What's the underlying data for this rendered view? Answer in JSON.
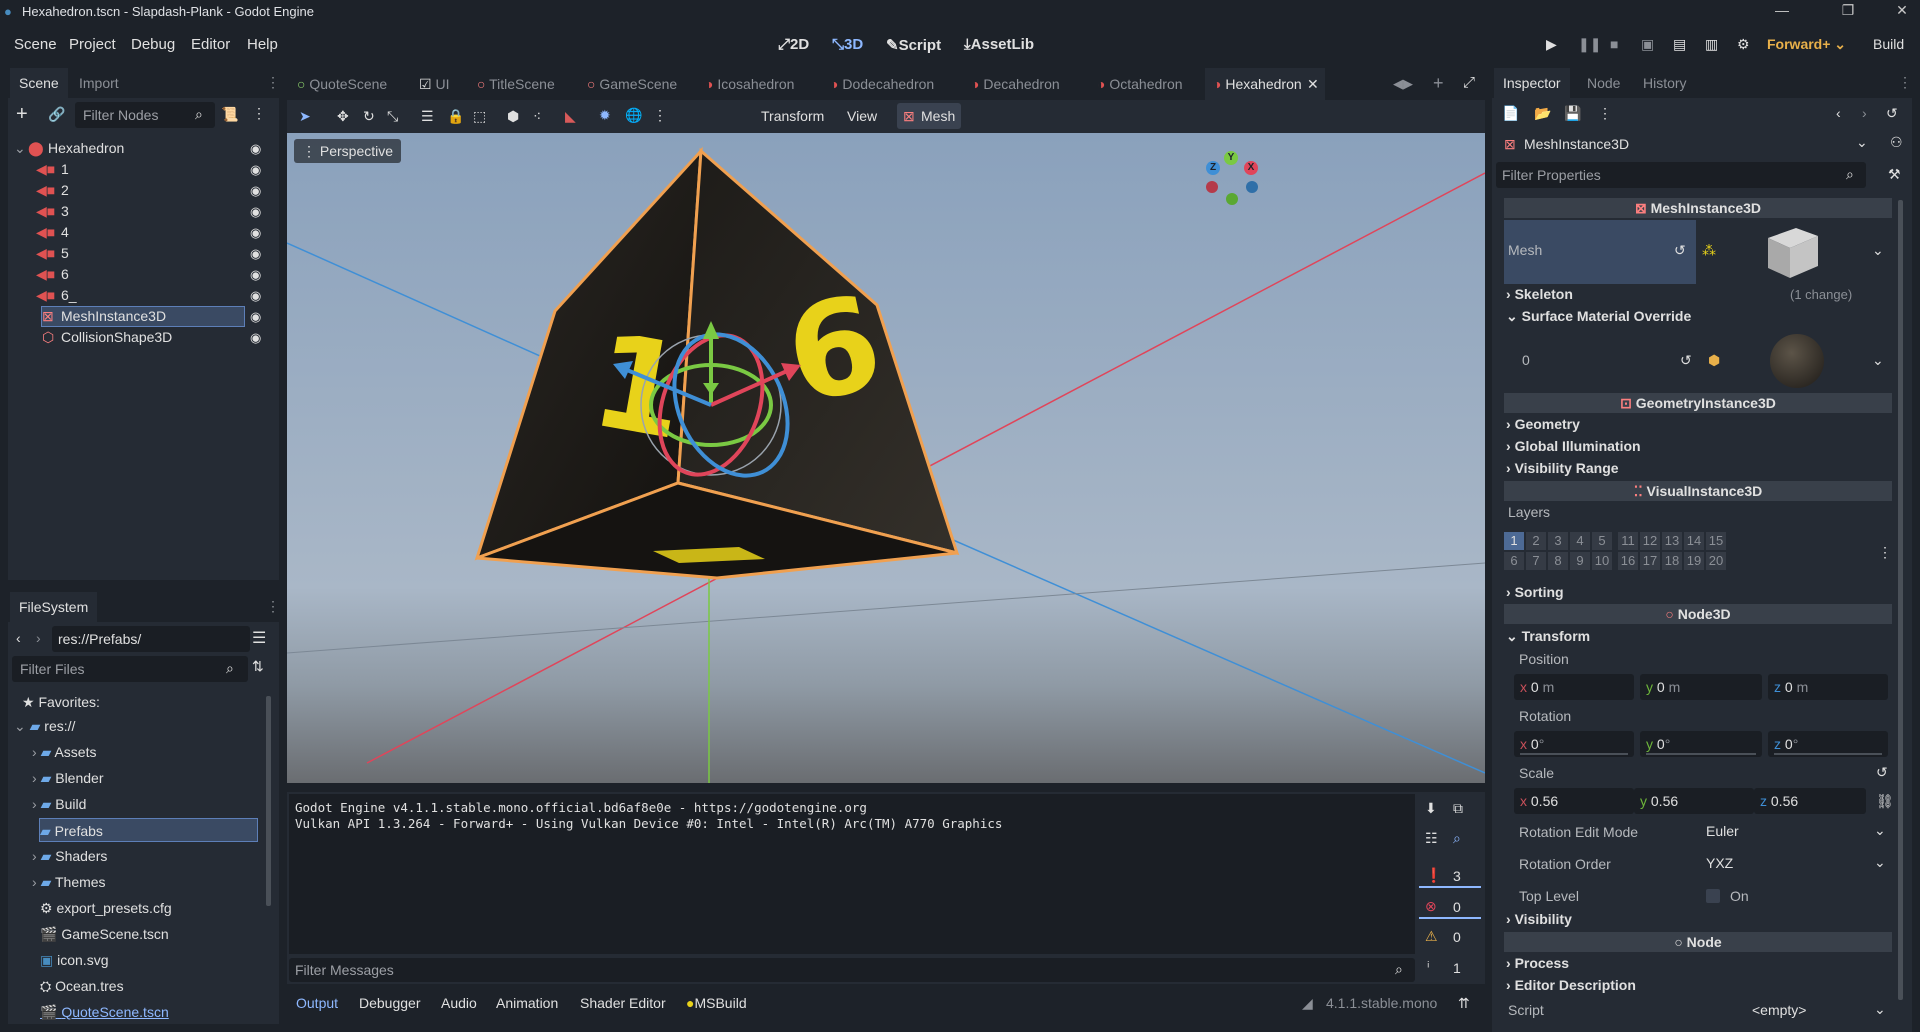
{
  "window": {
    "title": "Hexahedron.tscn - Slapdash-Plank - Godot Engine"
  },
  "menu": [
    "Scene",
    "Project",
    "Debug",
    "Editor",
    "Help"
  ],
  "workspaces": {
    "w2d": "2D",
    "w3d": "3D",
    "script": "Script",
    "assetlib": "AssetLib"
  },
  "renderer": "Forward+",
  "build_label": "Build",
  "scene_dock": {
    "tabs": [
      "Scene",
      "Import"
    ],
    "filter_placeholder": "Filter Nodes",
    "root": "Hexahedron",
    "children": [
      "1",
      "2",
      "3",
      "4",
      "5",
      "6",
      "6_",
      "MeshInstance3D",
      "CollisionShape3D"
    ],
    "selected": "MeshInstance3D"
  },
  "filesystem": {
    "tab": "FileSystem",
    "path": "res://Prefabs/",
    "filter_placeholder": "Filter Files",
    "favorites": "Favorites:",
    "root": "res://",
    "items": [
      "Assets",
      "Blender",
      "Build",
      "Prefabs",
      "Shaders",
      "Themes",
      "export_presets.cfg",
      "GameScene.tscn",
      "icon.svg",
      "Ocean.tres",
      "QuoteScene.tscn"
    ],
    "selected": "Prefabs"
  },
  "doc_tabs": [
    "QuoteScene",
    "UI",
    "TitleScene",
    "GameScene",
    "Icosahedron",
    "Dodecahedron",
    "Decahedron",
    "Octahedron",
    "Hexahedron"
  ],
  "active_doc": "Hexahedron",
  "toolbar": {
    "transform": "Transform",
    "view": "View",
    "mesh": "Mesh"
  },
  "viewport": {
    "perspective": "Perspective",
    "gizmo": {
      "x": "X",
      "y": "Y",
      "z": "Z"
    },
    "die_faces": [
      "1",
      "6"
    ]
  },
  "output": {
    "lines": [
      "Godot Engine v4.1.1.stable.mono.official.bd6af8e0e - https://godotengine.org",
      "Vulkan API 1.3.264 - Forward+ - Using Vulkan Device #0: Intel - Intel(R) Arc(TM) A770 Graphics"
    ],
    "filter_placeholder": "Filter Messages",
    "counts": {
      "messages": "3",
      "errors": "0",
      "warnings": "0",
      "info": "1"
    }
  },
  "bottom_tabs": [
    "Output",
    "Debugger",
    "Audio",
    "Animation",
    "Shader Editor",
    "MSBuild"
  ],
  "version": "4.1.1.stable.mono",
  "inspector": {
    "tabs": [
      "Inspector",
      "Node",
      "History"
    ],
    "node": "MeshInstance3D",
    "filter_placeholder": "Filter Properties",
    "class_mesh": "MeshInstance3D",
    "mesh_label": "Mesh",
    "skeleton": "Skeleton",
    "skeleton_note": "(1 change)",
    "surface_override": "Surface Material Override",
    "surface_index": "0",
    "class_geometry": "GeometryInstance3D",
    "geometry": "Geometry",
    "gi": "Global Illumination",
    "visibility_range": "Visibility Range",
    "class_visual": "VisualInstance3D",
    "layers_label": "Layers",
    "layers_row1": [
      "1",
      "2",
      "3",
      "4",
      "5",
      "11",
      "12",
      "13",
      "14",
      "15"
    ],
    "layers_row2": [
      "6",
      "7",
      "8",
      "9",
      "10",
      "16",
      "17",
      "18",
      "19",
      "20"
    ],
    "sorting": "Sorting",
    "class_node3d": "Node3D",
    "transform": "Transform",
    "position": "Position",
    "position_vals": {
      "x": "0",
      "y": "0",
      "z": "0",
      "unit": "m"
    },
    "rotation": "Rotation",
    "rotation_vals": {
      "x": "0",
      "y": "0",
      "z": "0",
      "unit": "°"
    },
    "scale": "Scale",
    "scale_vals": {
      "x": "0.56",
      "y": "0.56",
      "z": "0.56"
    },
    "rotation_edit_mode": "Rotation Edit Mode",
    "rotation_edit_mode_val": "Euler",
    "rotation_order": "Rotation Order",
    "rotation_order_val": "YXZ",
    "top_level": "Top Level",
    "top_level_val": "On",
    "visibility": "Visibility",
    "class_node": "Node",
    "process": "Process",
    "editor_description": "Editor Description",
    "script": "Script",
    "script_val": "<empty>"
  },
  "colors": {
    "accent": "#8eb8ff",
    "panel": "#252b34",
    "background": "#1d2229",
    "selection": "#3a4a63",
    "mesh_icon": "#fc7f7f",
    "node_icon": "#e05252"
  }
}
